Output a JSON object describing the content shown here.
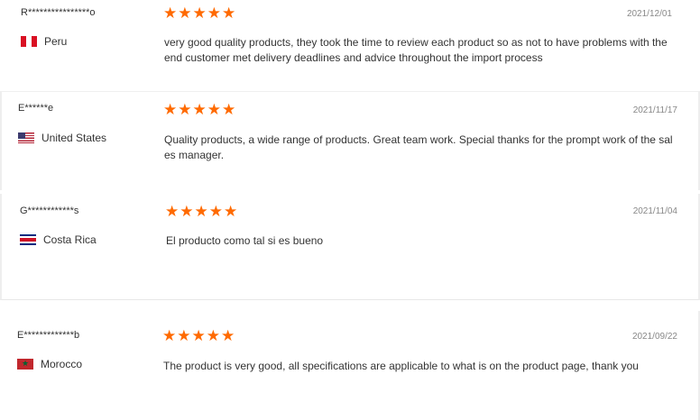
{
  "star_icon": "★",
  "star_color": "#ff6a00",
  "reviews": [
    {
      "user": "R****************o",
      "country": "Peru",
      "flag_icon": "peru-flag",
      "rating": 5,
      "date": "2021/12/01",
      "text": "very good quality products, they took the time to review each product so as not to have problems with the end customer met delivery deadlines and advice throughout the import process"
    },
    {
      "user": "E******e",
      "country": "United States",
      "flag_icon": "united-states-flag",
      "rating": 5,
      "date": "2021/11/17",
      "text": "Quality products, a wide range of products. Great team work. Special thanks for the prompt work of the sales manager."
    },
    {
      "user": "G************s",
      "country": "Costa Rica",
      "flag_icon": "costa-rica-flag",
      "rating": 5,
      "date": "2021/11/04",
      "text": "El producto como tal si es bueno"
    },
    {
      "user": "E*************b",
      "country": "Morocco",
      "flag_icon": "morocco-flag",
      "rating": 5,
      "date": "2021/09/22",
      "text": "The product is very good, all specifications are applicable to what is on the product page, thank you"
    }
  ]
}
